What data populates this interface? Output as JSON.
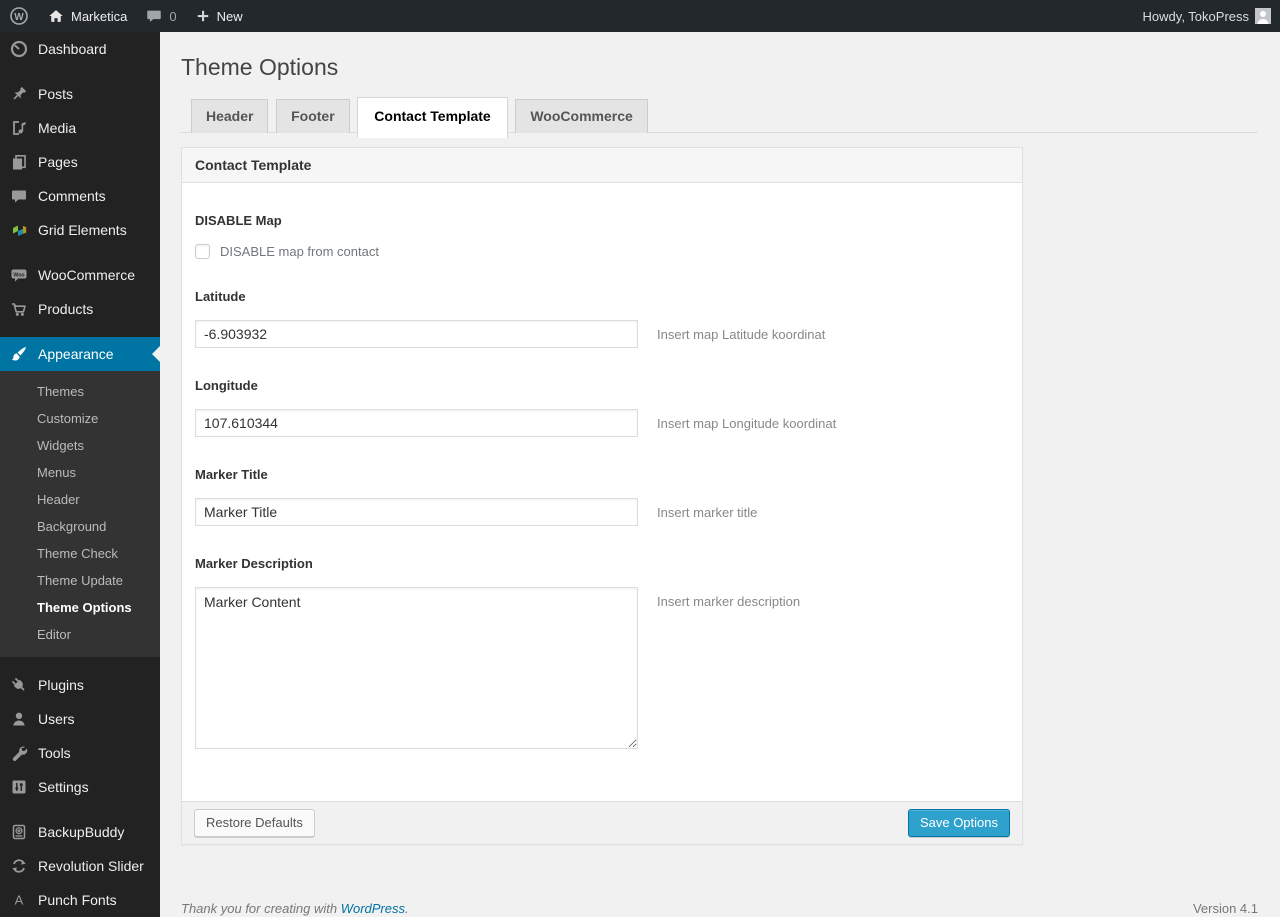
{
  "admin_bar": {
    "site_name": "Marketica",
    "comments_count": "0",
    "new_label": "New",
    "howdy_text": "Howdy, TokoPress"
  },
  "sidebar": {
    "items": [
      {
        "label": "Dashboard"
      },
      {
        "label": "Posts"
      },
      {
        "label": "Media"
      },
      {
        "label": "Pages"
      },
      {
        "label": "Comments"
      },
      {
        "label": "Grid Elements"
      },
      {
        "label": "WooCommerce"
      },
      {
        "label": "Products"
      },
      {
        "label": "Appearance"
      },
      {
        "label": "Plugins"
      },
      {
        "label": "Users"
      },
      {
        "label": "Tools"
      },
      {
        "label": "Settings"
      },
      {
        "label": "BackupBuddy"
      },
      {
        "label": "Revolution Slider"
      },
      {
        "label": "Punch Fonts"
      }
    ],
    "appearance_submenu": [
      {
        "label": "Themes"
      },
      {
        "label": "Customize"
      },
      {
        "label": "Widgets"
      },
      {
        "label": "Menus"
      },
      {
        "label": "Header"
      },
      {
        "label": "Background"
      },
      {
        "label": "Theme Check"
      },
      {
        "label": "Theme Update"
      },
      {
        "label": "Theme Options",
        "current": true
      },
      {
        "label": "Editor"
      }
    ]
  },
  "page": {
    "title": "Theme Options",
    "tabs": [
      {
        "label": "Header",
        "active": false
      },
      {
        "label": "Footer",
        "active": false
      },
      {
        "label": "Contact Template",
        "active": true
      },
      {
        "label": "WooCommerce",
        "active": false
      }
    ]
  },
  "panel": {
    "title": "Contact Template",
    "fields": {
      "disable_map": {
        "label": "DISABLE Map",
        "checkbox_label": "DISABLE map from contact",
        "checked": false
      },
      "latitude": {
        "label": "Latitude",
        "value": "-6.903932",
        "description": "Insert map Latitude koordinat"
      },
      "longitude": {
        "label": "Longitude",
        "value": "107.610344",
        "description": "Insert map Longitude koordinat"
      },
      "marker_title": {
        "label": "Marker Title",
        "value": "Marker Title",
        "description": "Insert marker title"
      },
      "marker_description": {
        "label": "Marker Description",
        "value": "Marker Content",
        "description": "Insert marker description"
      }
    },
    "footer": {
      "restore_label": "Restore Defaults",
      "save_label": "Save Options"
    }
  },
  "footer": {
    "thanks_prefix": "Thank you for creating with ",
    "wordpress_link": "WordPress",
    "thanks_suffix": ".",
    "version": "Version 4.1"
  },
  "colors": {
    "accent_blue": "#0074a2",
    "primary_button": "#2ea2cc",
    "admin_bar_bg": "#222222",
    "submenu_bg": "#333333",
    "page_bg": "#f1f1f1"
  }
}
